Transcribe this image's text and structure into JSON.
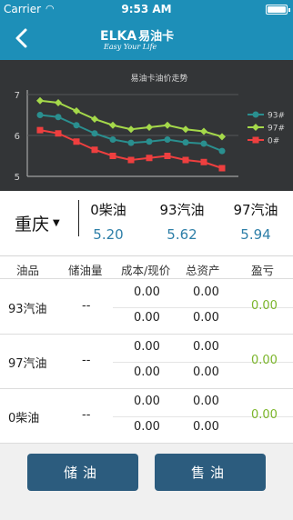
{
  "status": {
    "carrier": "Carrier",
    "time": "9:53 AM",
    "battery_level": 1.0
  },
  "nav": {
    "logo_text": "ELKA",
    "logo_cn": "易油卡",
    "logo_tagline": "Easy Your Life"
  },
  "chart_data": {
    "type": "line",
    "title": "易油卡油价走势",
    "ylim": [
      5,
      7
    ],
    "yticks": [
      "7",
      "6",
      "5"
    ],
    "grid": true,
    "legend_position": "right",
    "series": [
      {
        "name": "93#",
        "color": "#2a8f8f",
        "values": [
          6.5,
          6.45,
          6.25,
          6.05,
          5.9,
          5.82,
          5.85,
          5.9,
          5.83,
          5.8,
          5.62
        ]
      },
      {
        "name": "97#",
        "color": "#a5d94a",
        "values": [
          6.85,
          6.8,
          6.6,
          6.4,
          6.25,
          6.15,
          6.2,
          6.25,
          6.15,
          6.1,
          5.97
        ]
      },
      {
        "name": "0#",
        "color": "#ee3f3f",
        "values": [
          6.13,
          6.05,
          5.85,
          5.65,
          5.5,
          5.4,
          5.45,
          5.5,
          5.4,
          5.35,
          5.2
        ]
      }
    ]
  },
  "prices": {
    "city": "重庆",
    "items": [
      {
        "name": "0柴油",
        "value": "5.20"
      },
      {
        "name": "93汽油",
        "value": "5.62"
      },
      {
        "name": "97汽油",
        "value": "5.94"
      }
    ]
  },
  "table": {
    "headers": [
      "油品",
      "储油量",
      "成本/现价",
      "总资产",
      "盈亏"
    ],
    "rows": [
      {
        "fuel": "93汽油",
        "stock": "--",
        "cost": "0.00",
        "price": "0.00",
        "assets1": "0.00",
        "assets2": "0.00",
        "profit": "0.00"
      },
      {
        "fuel": "97汽油",
        "stock": "--",
        "cost": "0.00",
        "price": "0.00",
        "assets1": "0.00",
        "assets2": "0.00",
        "profit": "0.00"
      },
      {
        "fuel": "0柴油",
        "stock": "--",
        "cost": "0.00",
        "price": "0.00",
        "assets1": "0.00",
        "assets2": "0.00",
        "profit": "0.00"
      }
    ]
  },
  "actions": {
    "store": "储油",
    "sell": "售油"
  }
}
